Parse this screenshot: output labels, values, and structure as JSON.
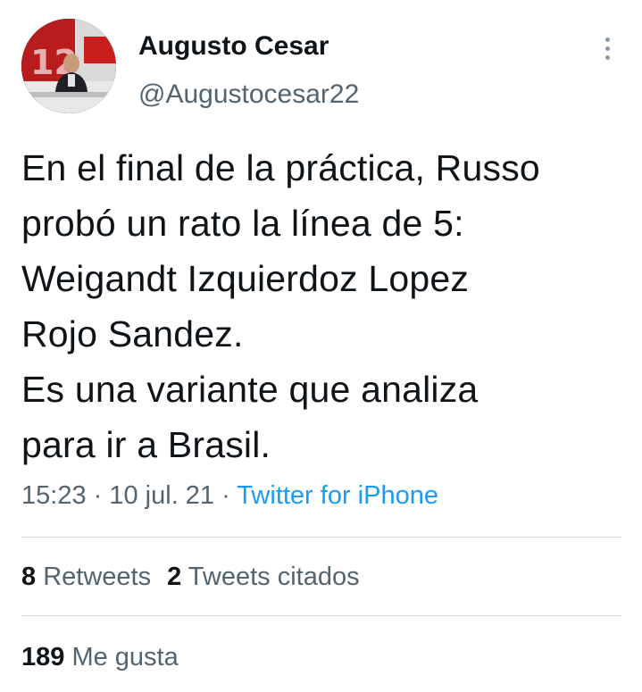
{
  "author": {
    "display_name": "Augusto Cesar",
    "handle": "@Augustocesar22",
    "avatar_icon": "profile-photo"
  },
  "more_icon": "more-options-icon",
  "tweet": {
    "text": "En el final de la práctica, Russo\nprobó un rato la línea de 5:\nWeigandt Izquierdoz Lopez\nRojo Sandez.\nEs una variante que analiza\npara ir a Brasil."
  },
  "meta": {
    "time": "15:23",
    "separator": " · ",
    "date": "10 jul. 21",
    "source": "Twitter for iPhone"
  },
  "stats": {
    "retweets_count": "8",
    "retweets_label": " Retweets",
    "quotes_count": "2",
    "quotes_label": " Tweets citados",
    "likes_count": "189",
    "likes_label": " Me gusta"
  },
  "colors": {
    "text": "#0f1419",
    "secondary": "#536471",
    "link": "#1d9bf0",
    "divider": "#cfd9de"
  }
}
